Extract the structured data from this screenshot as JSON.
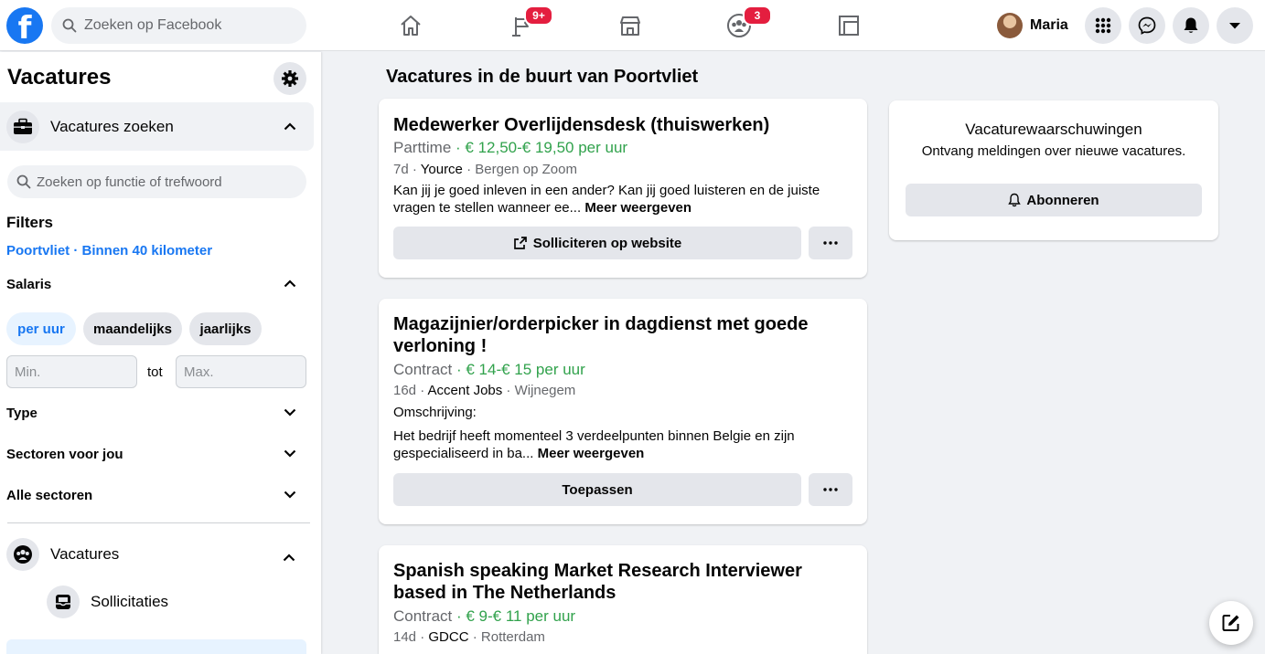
{
  "topbar": {
    "search_placeholder": "Zoeken op Facebook",
    "nav": [
      {
        "name": "home",
        "badge": ""
      },
      {
        "name": "pages",
        "badge": "9+"
      },
      {
        "name": "marketplace",
        "badge": ""
      },
      {
        "name": "groups",
        "badge": "3"
      },
      {
        "name": "gaming",
        "badge": ""
      }
    ],
    "profile_name": "Maria"
  },
  "sidebar": {
    "title": "Vacatures",
    "search_jobs_label": "Vacatures zoeken",
    "search_placeholder": "Zoeken op functie of trefwoord",
    "filters_title": "Filters",
    "location": "Poortvliet · Binnen 40 kilometer",
    "salary_label": "Salaris",
    "salary_chips": [
      "per uur",
      "maandelijks",
      "jaarlijks"
    ],
    "min_placeholder": "Min.",
    "to_label": "tot",
    "max_placeholder": "Max.",
    "type_label": "Type",
    "sectors_for_you_label": "Sectoren voor jou",
    "all_sectors_label": "Alle sectoren",
    "jobs_label": "Vacatures",
    "applications_label": "Sollicitaties"
  },
  "main": {
    "title": "Vacatures in de buurt van Poortvliet",
    "jobs": [
      {
        "title": "Medewerker Overlijdensdesk (thuiswerken)",
        "type": "Parttime",
        "salary": " · € 12,50-€ 19,50 per uur",
        "age": "7d",
        "company": "Yource",
        "location": "Bergen op Zoom",
        "desc": "Kan jij je goed inleven in een ander? Kan jij goed luisteren en de juiste vragen te stellen wanneer ee...",
        "desc_intro": "",
        "more": "Meer weergeven",
        "action": "Solliciteren op website"
      },
      {
        "title": "Magazijnier/orderpicker in dagdienst met goede verloning !",
        "type": "Contract",
        "salary": " · € 14-€ 15 per uur",
        "age": "16d",
        "company": "Accent Jobs",
        "location": "Wijnegem",
        "desc_intro": "Omschrijving:",
        "desc": "Het bedrijf heeft momenteel 3 verdeelpunten binnen Belgie en zijn gespecialiseerd in ba...",
        "more": "Meer weergeven",
        "action": "Toepassen"
      },
      {
        "title": "Spanish speaking Market Research Interviewer based in The Netherlands",
        "type": "Contract",
        "salary": " · € 9-€ 11 per uur",
        "age": "14d",
        "company": "GDCC",
        "location": "Rotterdam"
      }
    ]
  },
  "alerts": {
    "title": "Vacaturewaarschuwingen",
    "subtitle": "Ontvang meldingen over nieuwe vacatures.",
    "button": "Abonneren"
  },
  "colors": {
    "brand": "#1877f2",
    "salary": "#31a24c",
    "badge": "#e41e3f"
  }
}
